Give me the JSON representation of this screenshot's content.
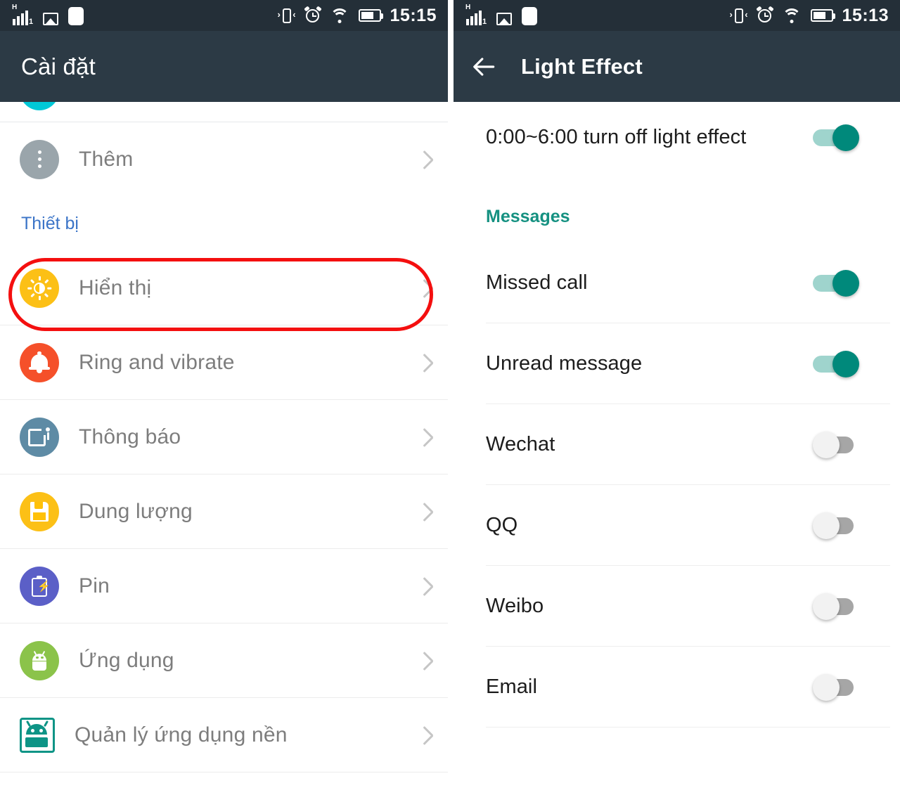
{
  "left_screen": {
    "status_bar": {
      "network_type": "H",
      "sim_label": "1",
      "time": "15:15",
      "icons": [
        "signal-bars-icon",
        "image-icon",
        "blank-square-icon",
        "vibrate-icon",
        "alarm-icon",
        "wifi-icon",
        "battery-icon"
      ]
    },
    "app_bar": {
      "title": "Cài đặt"
    },
    "section_header": "Thiết bị",
    "items": [
      {
        "label": "Thêm",
        "icon": "more-dots-icon",
        "color": "#9aa5ab"
      },
      {
        "label": "Hiển thị",
        "icon": "brightness-icon",
        "color": "#fcc016"
      },
      {
        "label": "Ring and vibrate",
        "icon": "bell-icon",
        "color": "#f5502a"
      },
      {
        "label": "Thông báo",
        "icon": "notification-icon",
        "color": "#5e8ba5"
      },
      {
        "label": "Dung lượng",
        "icon": "save-disk-icon",
        "color": "#fcc016"
      },
      {
        "label": "Pin",
        "icon": "battery-icon",
        "color": "#5b5fc7"
      },
      {
        "label": "Ứng dụng",
        "icon": "android-icon",
        "color": "#8bc34a"
      },
      {
        "label": "Quản lý ứng dụng nền",
        "icon": "android-square-icon",
        "color": "#0e9486"
      }
    ]
  },
  "right_screen": {
    "status_bar": {
      "network_type": "H",
      "sim_label": "1",
      "time": "15:13",
      "icons": [
        "signal-bars-icon",
        "image-icon",
        "blank-square-icon",
        "vibrate-icon",
        "alarm-icon",
        "wifi-icon",
        "battery-icon"
      ]
    },
    "app_bar": {
      "back": "back-arrow-icon",
      "title": "Light Effect"
    },
    "schedule_row": {
      "label": "0:00~6:00 turn off light effect",
      "state": "on"
    },
    "section_header": "Messages",
    "toggles": [
      {
        "label": "Missed call",
        "state": "on"
      },
      {
        "label": "Unread message",
        "state": "on"
      },
      {
        "label": "Wechat",
        "state": "off"
      },
      {
        "label": "QQ",
        "state": "off"
      },
      {
        "label": "Weibo",
        "state": "off"
      },
      {
        "label": "Email",
        "state": "off"
      }
    ]
  },
  "annotations": {
    "highlight_color": "#f40f0f",
    "left_box_target": "Hiển thị",
    "right_box_target": "light-effect-settings-list"
  },
  "theme": {
    "status_bar_bg": "#242f38",
    "app_bar_bg": "#2c3a45",
    "toggle_on": "#00897b",
    "toggle_on_track": "#9fd4cd",
    "toggle_off": "#a6a6a6",
    "section_blue": "#3b74c7",
    "section_teal": "#159181"
  }
}
